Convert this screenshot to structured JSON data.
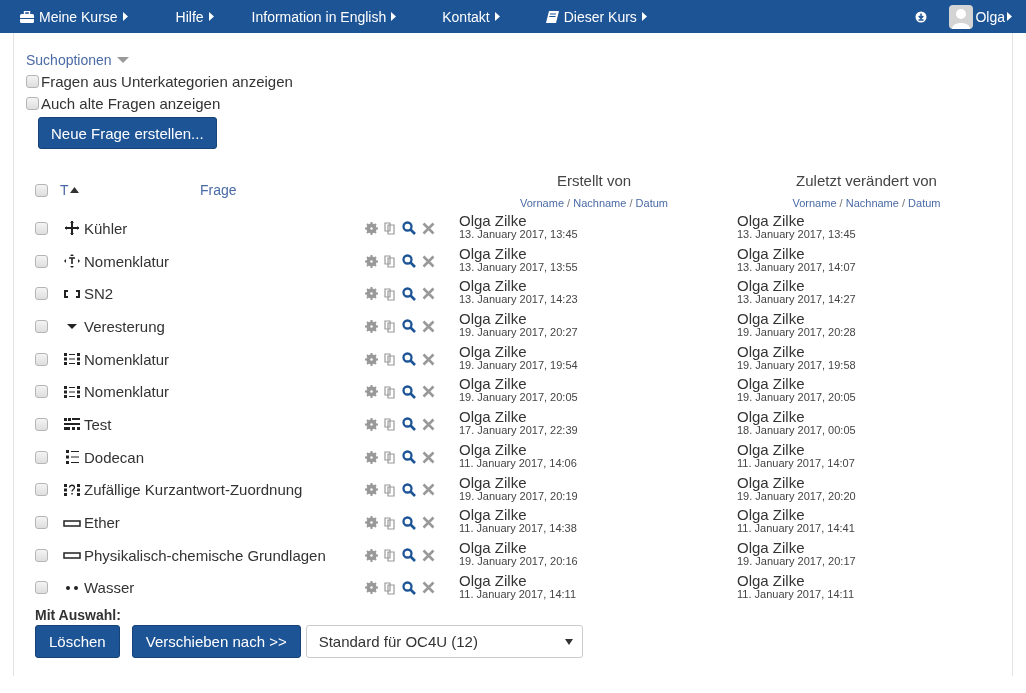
{
  "navbar": {
    "menus": [
      {
        "label": "Meine Kurse",
        "kind": "briefcase"
      },
      {
        "label": "Hilfe",
        "kind": "plain"
      },
      {
        "label": "Information in English",
        "kind": "plain"
      },
      {
        "label": "Kontakt",
        "kind": "plain"
      },
      {
        "label": "Dieser Kurs",
        "kind": "book"
      }
    ],
    "user": {
      "name": "Olga"
    }
  },
  "search_options": {
    "label": "Suchoptionen",
    "options": [
      {
        "label": "Fragen aus Unterkategorien anzeigen",
        "checked": false
      },
      {
        "label": "Auch alte Fragen anzeigen",
        "checked": false
      }
    ],
    "create_button": "Neue Frage erstellen..."
  },
  "table": {
    "columns": {
      "select_all": {
        "checked": false
      },
      "type": "T",
      "question": "Frage",
      "created": "Erstellt von",
      "modified": "Zuletzt verändert von",
      "sort_separator": "/",
      "sort_links": [
        [
          "Vorname",
          "Nachname",
          "Datum"
        ],
        [
          "Vorname",
          "Nachname",
          "Datum"
        ]
      ]
    },
    "rows": [
      {
        "selected": false,
        "kind": "ddmarker",
        "name": "Kühler",
        "created_by": "Olga Zilke",
        "created": "13. January 2017, 13:45",
        "modified_by": "Olga Zilke",
        "modified": "13. January 2017, 13:45"
      },
      {
        "selected": false,
        "kind": "ddimage",
        "name": "Nomenklatur",
        "created_by": "Olga Zilke",
        "created": "13. January 2017, 13:55",
        "modified_by": "Olga Zilke",
        "modified": "13. January 2017, 14:07"
      },
      {
        "selected": false,
        "kind": "gapselect",
        "name": "SN2",
        "created_by": "Olga Zilke",
        "created": "13. January 2017, 14:23",
        "modified_by": "Olga Zilke",
        "modified": "13. January 2017, 14:27"
      },
      {
        "selected": false,
        "kind": "dropdown",
        "name": "Veresterung",
        "created_by": "Olga Zilke",
        "created": "19. January 2017, 20:27",
        "modified_by": "Olga Zilke",
        "modified": "19. January 2017, 20:28"
      },
      {
        "selected": false,
        "kind": "match",
        "name": "Nomenklatur",
        "created_by": "Olga Zilke",
        "created": "19. January 2017, 19:54",
        "modified_by": "Olga Zilke",
        "modified": "19. January 2017, 19:58"
      },
      {
        "selected": false,
        "kind": "match",
        "name": "Nomenklatur",
        "created_by": "Olga Zilke",
        "created": "19. January 2017, 20:05",
        "modified_by": "Olga Zilke",
        "modified": "19. January 2017, 20:05"
      },
      {
        "selected": false,
        "kind": "gapfill",
        "name": "Test",
        "created_by": "Olga Zilke",
        "created": "17. January 2017, 22:39",
        "modified_by": "Olga Zilke",
        "modified": "18. January 2017, 00:05"
      },
      {
        "selected": false,
        "kind": "list",
        "name": "Dodecan",
        "created_by": "Olga Zilke",
        "created": "11. January 2017, 14:06",
        "modified_by": "Olga Zilke",
        "modified": "11. January 2017, 14:07"
      },
      {
        "selected": false,
        "kind": "randommatch",
        "name": "Zufällige Kurzantwort-Zuordnung",
        "created_by": "Olga Zilke",
        "created": "19. January 2017, 20:19",
        "modified_by": "Olga Zilke",
        "modified": "19. January 2017, 20:20"
      },
      {
        "selected": false,
        "kind": "shortanswer",
        "name": "Ether",
        "created_by": "Olga Zilke",
        "created": "11. January 2017, 14:38",
        "modified_by": "Olga Zilke",
        "modified": "11. January 2017, 14:41"
      },
      {
        "selected": false,
        "kind": "shortanswer",
        "name": "Physikalisch-chemische Grundlagen",
        "created_by": "Olga Zilke",
        "created": "19. January 2017, 20:16",
        "modified_by": "Olga Zilke",
        "modified": "19. January 2017, 20:17"
      },
      {
        "selected": false,
        "kind": "dots",
        "name": "Wasser",
        "created_by": "Olga Zilke",
        "created": "11. January 2017, 14:11",
        "modified_by": "Olga Zilke",
        "modified": "11. January 2017, 14:11"
      }
    ]
  },
  "bulk_actions": {
    "label": "Mit Auswahl:",
    "delete_button": "Löschen",
    "move_button": "Verschieben nach >>",
    "category": "Standard für OC4U (12)"
  }
}
